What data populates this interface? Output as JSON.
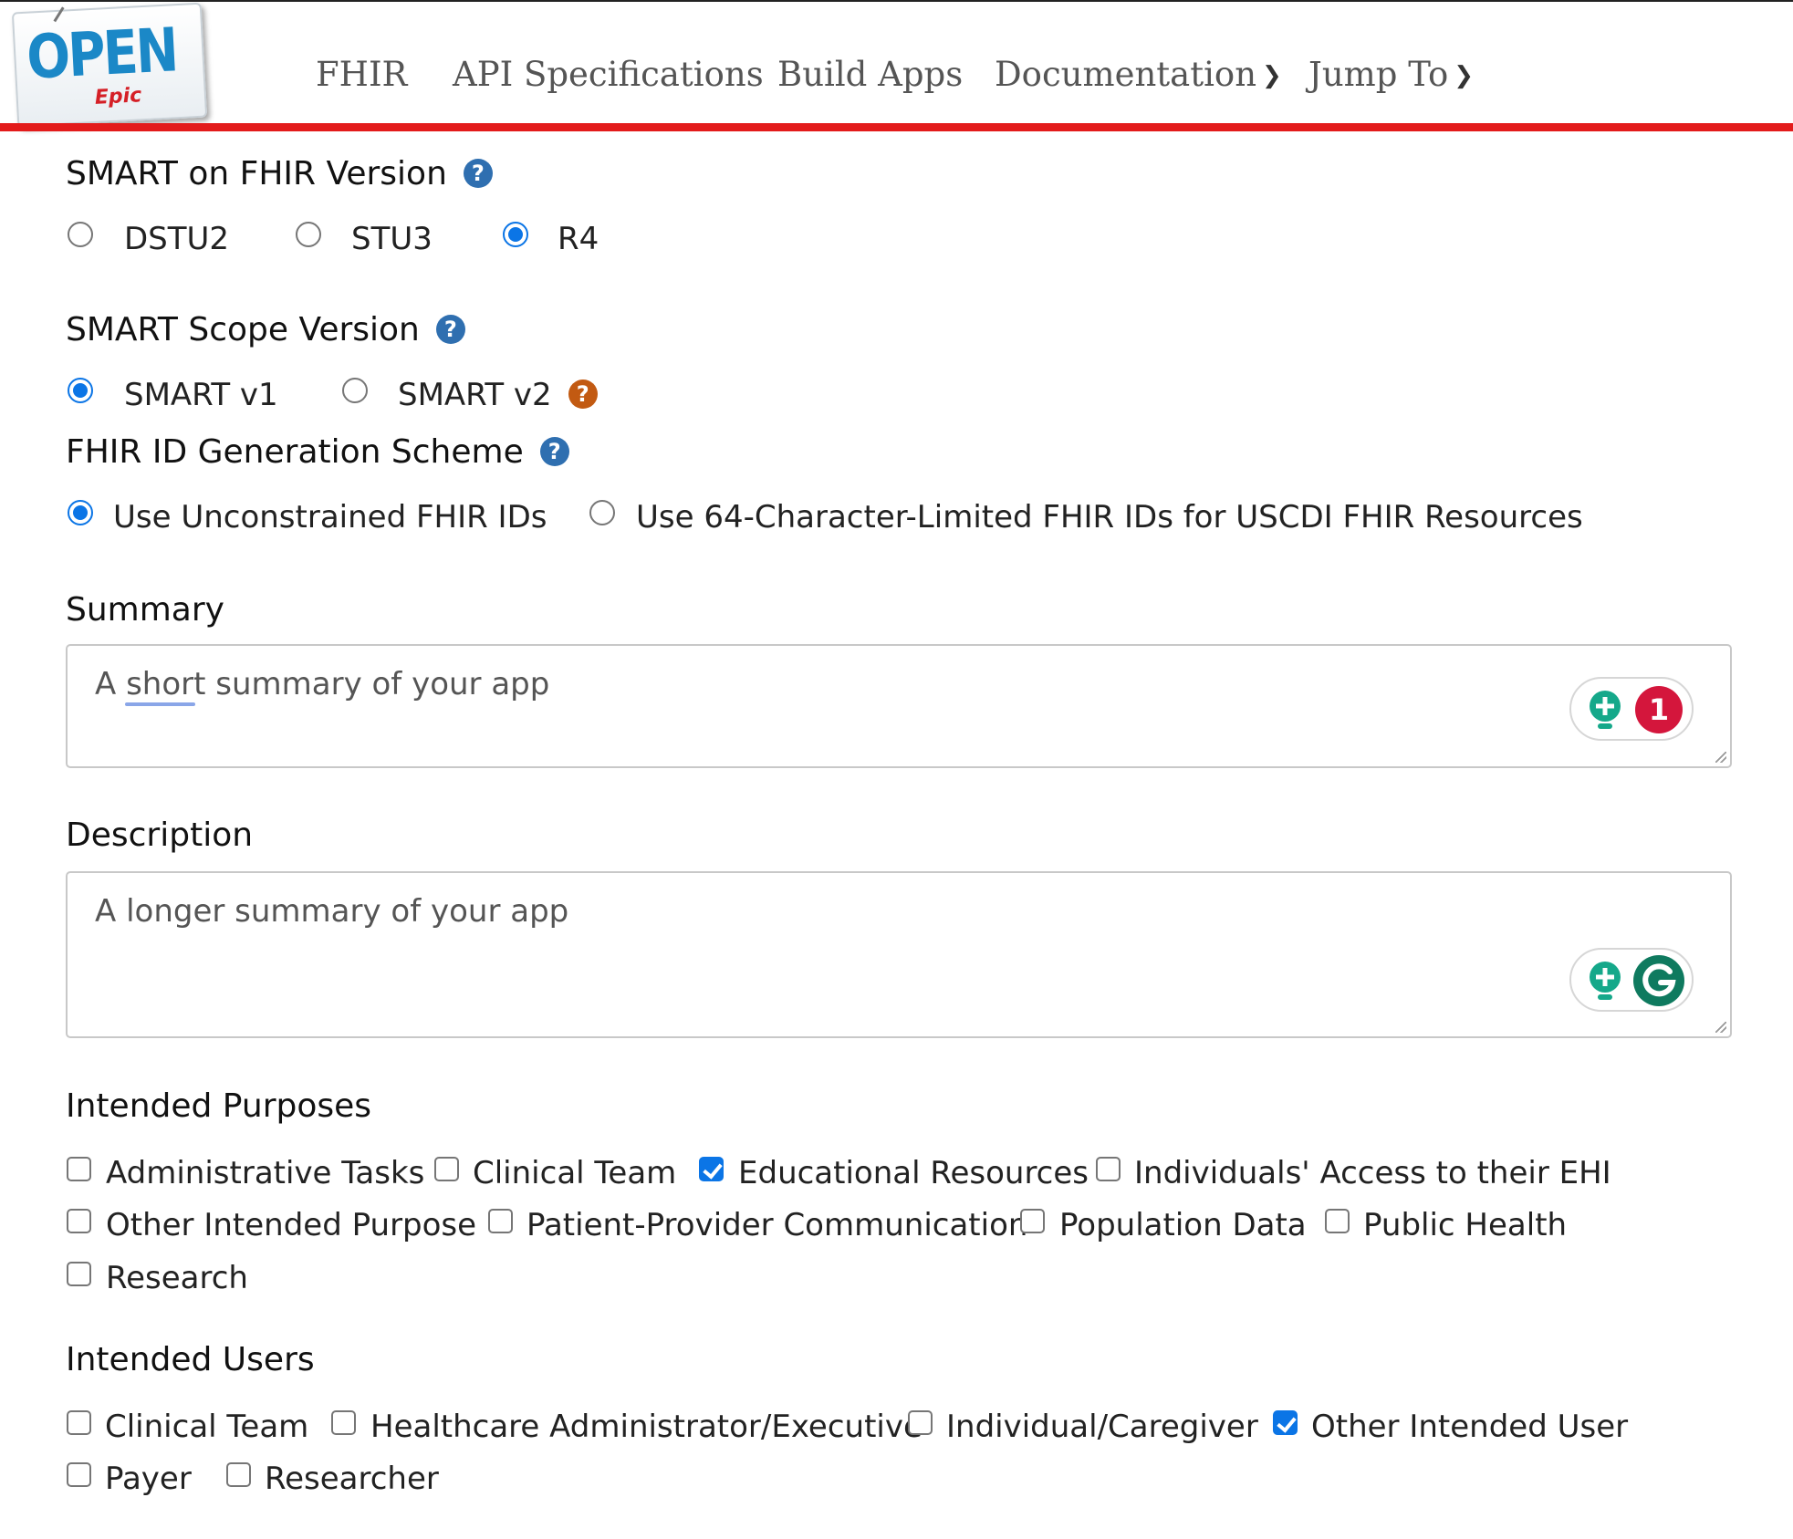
{
  "nav": {
    "items": [
      {
        "label": "FHIR"
      },
      {
        "label": "API Specifications"
      },
      {
        "label": "Build Apps"
      },
      {
        "label": "Documentation",
        "icon": "chevron-down-icon"
      },
      {
        "label": "Jump To",
        "icon": "chevron-down-icon"
      }
    ]
  },
  "logo": {
    "main": "OPEN",
    "sub": "Epic"
  },
  "fhir_version": {
    "label": "SMART on FHIR Version",
    "options": [
      {
        "label": "DSTU2",
        "selected": false
      },
      {
        "label": "STU3",
        "selected": false
      },
      {
        "label": "R4",
        "selected": true
      }
    ]
  },
  "scope_version": {
    "label": "SMART Scope Version",
    "options": [
      {
        "label": "SMART v1",
        "selected": true
      },
      {
        "label": "SMART v2",
        "selected": false
      }
    ]
  },
  "id_scheme": {
    "label": "FHIR ID Generation Scheme",
    "options": [
      {
        "label": "Use Unconstrained FHIR IDs",
        "selected": true
      },
      {
        "label": "Use 64-Character-Limited FHIR IDs for USCDI FHIR Resources",
        "selected": false
      }
    ]
  },
  "summary": {
    "label": "Summary",
    "placeholder": "A short summary of your app",
    "issue_count": "1"
  },
  "description": {
    "label": "Description",
    "placeholder": "A longer summary of your app"
  },
  "help_glyph": "?",
  "intended_purposes": {
    "label": "Intended Purposes",
    "options": [
      {
        "label": "Administrative Tasks",
        "checked": false
      },
      {
        "label": "Clinical Team",
        "checked": false
      },
      {
        "label": "Educational Resources",
        "checked": true
      },
      {
        "label": "Individuals' Access to their EHI",
        "checked": false
      },
      {
        "label": "Other Intended Purpose",
        "checked": false
      },
      {
        "label": "Patient-Provider Communication",
        "checked": false
      },
      {
        "label": "Population Data",
        "checked": false
      },
      {
        "label": "Public Health",
        "checked": false
      },
      {
        "label": "Research",
        "checked": false
      }
    ]
  },
  "intended_users": {
    "label": "Intended Users",
    "options": [
      {
        "label": "Clinical Team",
        "checked": false
      },
      {
        "label": "Healthcare Administrator/Executive",
        "checked": false
      },
      {
        "label": "Individual/Caregiver",
        "checked": false
      },
      {
        "label": "Other Intended User",
        "checked": true
      },
      {
        "label": "Payer",
        "checked": false
      },
      {
        "label": "Researcher",
        "checked": false
      }
    ]
  },
  "colors": {
    "accent": "#0b75e6",
    "header_rule": "#e31b1b",
    "help": "#2f6fb0",
    "help_warn": "#c25a12",
    "grammarly_badge": "#d4163c"
  }
}
